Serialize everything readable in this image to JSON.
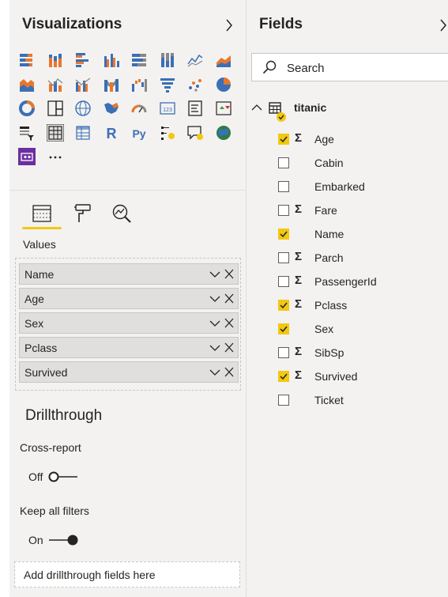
{
  "visualizations": {
    "title": "Visualizations",
    "icons": [
      "stacked-bar-chart-icon",
      "stacked-column-chart-icon",
      "clustered-bar-chart-icon",
      "clustered-column-chart-icon",
      "100-stacked-bar-chart-icon",
      "100-stacked-column-chart-icon",
      "line-chart-icon",
      "area-chart-icon",
      "stacked-area-chart-icon",
      "line-and-stacked-column-chart-icon",
      "line-and-clustered-column-chart-icon",
      "ribbon-chart-icon",
      "waterfall-chart-icon",
      "funnel-chart-icon",
      "scatter-chart-icon",
      "pie-chart-icon",
      "donut-chart-icon",
      "treemap-icon",
      "map-icon",
      "filled-map-icon",
      "gauge-icon",
      "card-icon",
      "multi-row-card-icon",
      "kpi-icon",
      "slicer-icon",
      "table-icon",
      "matrix-icon",
      "r-script-visual-icon",
      "python-visual-icon",
      "key-influencers-icon",
      "qa-visual-icon",
      "arcgis-map-icon",
      "custom-visual-icon",
      "more-visuals-icon"
    ],
    "more_label": "···",
    "tabs": [
      "fields-tab-icon",
      "format-tab-icon",
      "analytics-tab-icon"
    ],
    "values_label": "Values",
    "values": [
      {
        "label": "Name"
      },
      {
        "label": "Age"
      },
      {
        "label": "Sex"
      },
      {
        "label": "Pclass"
      },
      {
        "label": "Survived"
      }
    ],
    "drillthrough": {
      "title": "Drillthrough",
      "cross_report_label": "Cross-report",
      "cross_report_state": "Off",
      "keep_filters_label": "Keep all filters",
      "keep_filters_state": "On",
      "drop_placeholder": "Add drillthrough fields here"
    }
  },
  "fields": {
    "title": "Fields",
    "search_placeholder": "Search",
    "table_name": "titanic",
    "items": [
      {
        "name": "Age",
        "checked": true,
        "sigma": true
      },
      {
        "name": "Cabin",
        "checked": false,
        "sigma": false
      },
      {
        "name": "Embarked",
        "checked": false,
        "sigma": false
      },
      {
        "name": "Fare",
        "checked": false,
        "sigma": true
      },
      {
        "name": "Name",
        "checked": true,
        "sigma": false
      },
      {
        "name": "Parch",
        "checked": false,
        "sigma": true
      },
      {
        "name": "PassengerId",
        "checked": false,
        "sigma": true
      },
      {
        "name": "Pclass",
        "checked": true,
        "sigma": true
      },
      {
        "name": "Sex",
        "checked": true,
        "sigma": false
      },
      {
        "name": "SibSp",
        "checked": false,
        "sigma": true
      },
      {
        "name": "Survived",
        "checked": true,
        "sigma": true
      },
      {
        "name": "Ticket",
        "checked": false,
        "sigma": false
      }
    ]
  },
  "colors": {
    "accent_yellow": "#f2c811",
    "pane_bg": "#f3f2f1",
    "chart_orange": "#e8772e",
    "chart_blue": "#3b6fb6",
    "custom_visual_purple": "#6b2fa0"
  }
}
